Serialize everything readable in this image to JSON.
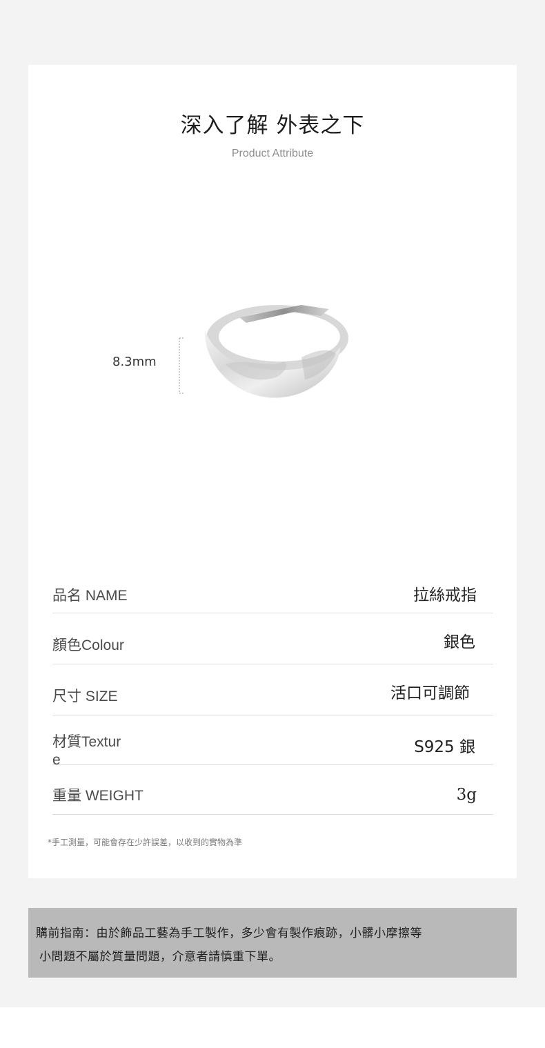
{
  "header": {
    "title": "深入了解 外表之下",
    "subtitle": "Product Attribute"
  },
  "product_image": {
    "dimension_label": "8.3mm"
  },
  "specs": [
    {
      "label": "品名 NAME",
      "value": "拉絲戒指"
    },
    {
      "label": "顏色Colour",
      "value": "銀色"
    },
    {
      "label": "尺寸 SIZE",
      "value": "活口可調節"
    },
    {
      "label": "材質Textur\ne",
      "value": "S925 銀"
    },
    {
      "label": "重量 WEIGHT",
      "value": "3g"
    }
  ],
  "note": "*手工測量，可能會存在少許誤差，以收到的實物為準",
  "guide": {
    "line1": "購前指南：由於飾品工藝為手工製作，多少會有製作痕跡，小髒小摩擦等",
    "line2": "小問題不屬於質量問題，介意者請慎重下單。"
  }
}
